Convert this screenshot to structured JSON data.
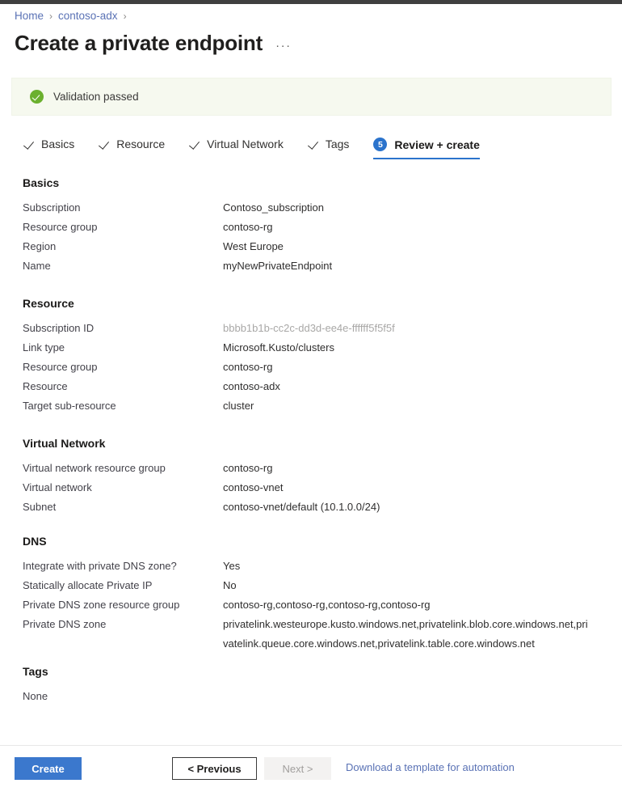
{
  "breadcrumb": {
    "items": [
      "Home",
      "contoso-adx"
    ],
    "separator": "›"
  },
  "header": {
    "title": "Create a private endpoint",
    "ellipsis": "···"
  },
  "banner": {
    "text": "Validation passed",
    "icon": "check-circle-icon",
    "background": "#f6f9ef",
    "icon_color": "#6bb02e"
  },
  "tabs": [
    {
      "label": "Basics",
      "state": "complete",
      "marker": "✓"
    },
    {
      "label": "Resource",
      "state": "complete",
      "marker": "✓"
    },
    {
      "label": "Virtual Network",
      "state": "complete",
      "marker": "✓"
    },
    {
      "label": "Tags",
      "state": "complete",
      "marker": "✓"
    },
    {
      "label": "Review + create",
      "state": "active",
      "marker": "5"
    }
  ],
  "sections": {
    "basics": {
      "title": "Basics",
      "rows": [
        {
          "label": "Subscription",
          "value": "Contoso_subscription"
        },
        {
          "label": "Resource group",
          "value": "contoso-rg"
        },
        {
          "label": "Region",
          "value": "West Europe"
        },
        {
          "label": "Name",
          "value": "myNewPrivateEndpoint"
        }
      ]
    },
    "resource": {
      "title": "Resource",
      "rows": [
        {
          "label": "Subscription ID",
          "value": "bbbb1b1b-cc2c-dd3d-ee4e-ffffff5f5f5f"
        },
        {
          "label": "Link type",
          "value": "Microsoft.Kusto/clusters"
        },
        {
          "label": "Resource group",
          "value": "contoso-rg"
        },
        {
          "label": "Resource",
          "value": "contoso-adx"
        },
        {
          "label": "Target sub-resource",
          "value": "cluster"
        }
      ]
    },
    "virtual_network": {
      "title": "Virtual Network",
      "rows": [
        {
          "label": "Virtual network resource group",
          "value": "contoso-rg"
        },
        {
          "label": "Virtual network",
          "value": "contoso-vnet"
        },
        {
          "label": "Subnet",
          "value": "contoso-vnet/default (10.1.0.0/24)"
        }
      ]
    },
    "dns": {
      "title": "DNS",
      "rows": [
        {
          "label": "Integrate with private DNS zone?",
          "value": "Yes"
        },
        {
          "label": "Statically allocate Private IP",
          "value": "No"
        },
        {
          "label": "Private DNS zone resource group",
          "value": "contoso-rg,contoso-rg,contoso-rg,contoso-rg"
        },
        {
          "label": "Private DNS zone",
          "value": "privatelink.westeurope.kusto.windows.net,privatelink.blob.core.windows.net,privatelink.queue.core.windows.net,privatelink.table.core.windows.net"
        }
      ]
    },
    "tags": {
      "title": "Tags",
      "empty_value": "None"
    }
  },
  "footer": {
    "create_label": "Create",
    "previous_label": "< Previous",
    "next_label": "Next >",
    "download_label": "Download a template for automation",
    "accent_color": "#3b78cd"
  }
}
